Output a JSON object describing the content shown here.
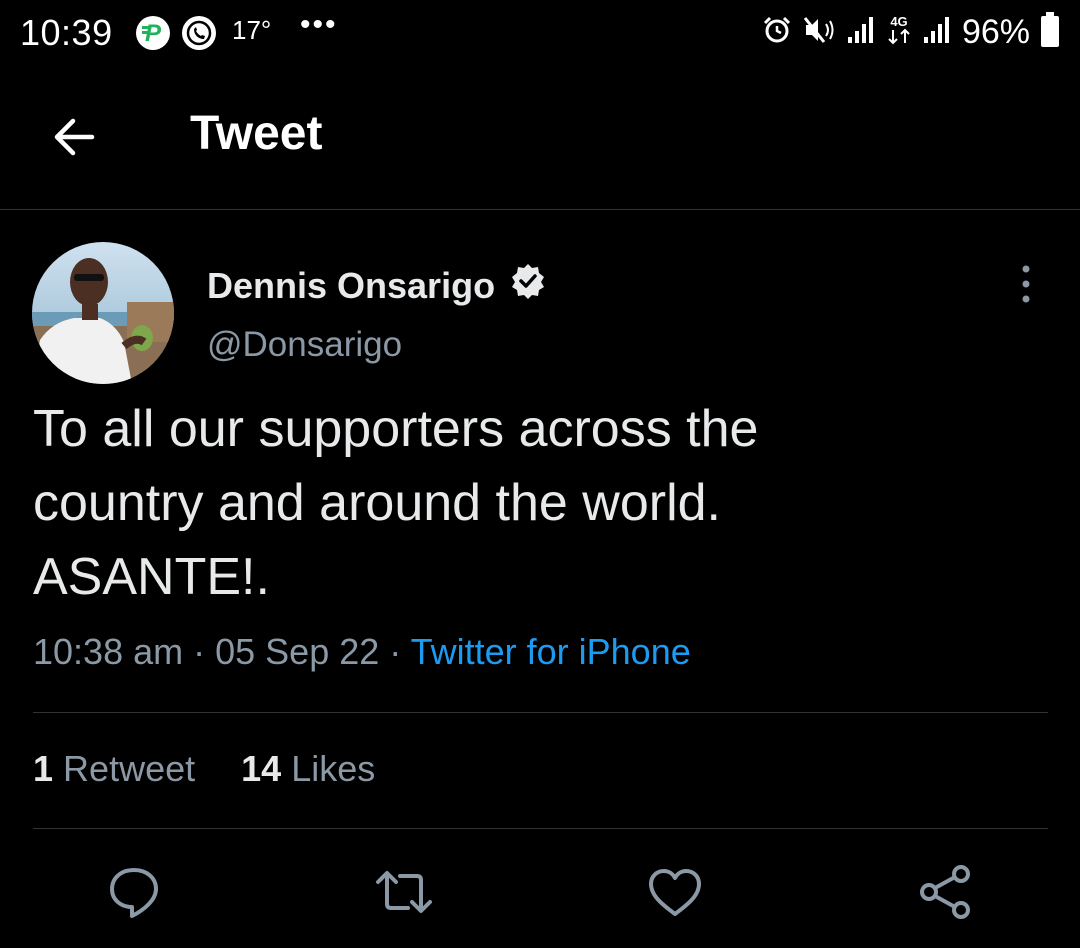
{
  "status_bar": {
    "time": "10:39",
    "temperature": "17°",
    "more": "•••",
    "battery_percent": "96%",
    "icons": [
      "pesa-app-icon",
      "whatsapp-icon",
      "alarm-icon",
      "mute-icon",
      "signal-icon",
      "4g-icon",
      "signal-icon",
      "battery-icon"
    ]
  },
  "header": {
    "title": "Tweet",
    "back_icon": "arrow-left-icon"
  },
  "tweet": {
    "author_name": "Dennis Onsarigo",
    "verified": true,
    "handle": "@Donsarigo",
    "text": "To all our supporters across the\ncountry and around the world.\nASANTE!.",
    "time": "10:38 am",
    "separator": " · ",
    "date": "05 Sep 22",
    "source": "Twitter for iPhone",
    "retweet_count": "1",
    "retweet_label": "Retweet",
    "like_count": "14",
    "like_label": "Likes"
  },
  "actions": [
    "reply-icon",
    "retweet-icon",
    "like-icon",
    "share-icon"
  ],
  "colors": {
    "background": "#000000",
    "text": "#e7e9ea",
    "secondary": "#8b98a5",
    "link": "#1d9bf0",
    "divider": "#2f3336"
  }
}
